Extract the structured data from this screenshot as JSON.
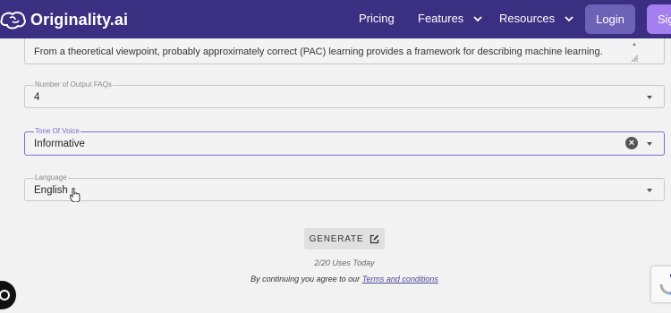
{
  "header": {
    "logo_text": "Originality.ai",
    "nav": [
      {
        "label": "Pricing"
      },
      {
        "label": "Features"
      },
      {
        "label": "Resources"
      }
    ],
    "login_label": "Login",
    "signup_label": "Sig"
  },
  "form": {
    "text_value": "From a theoretical viewpoint, probably approximately correct (PAC) learning provides a framework for describing machine learning.",
    "faqs": {
      "label": "Number of Output FAQs",
      "value": "4"
    },
    "tone": {
      "label": "Tone Of Voice",
      "value": "Informative"
    },
    "language": {
      "label": "Language",
      "value": "English"
    }
  },
  "actions": {
    "generate_label": "GENERATE",
    "uses_text": "2/20 Uses Today",
    "terms_prefix": "By continuing you agree to our ",
    "terms_link": "Terms and conditions"
  },
  "colors": {
    "nav_background": "#3b2f82",
    "focus_border": "#7a6fd1",
    "login_button": "#6d62b8",
    "signup_button": "#a47ff0"
  },
  "icons": [
    "brain-logo-icon",
    "chevron-down-icon",
    "clear-icon",
    "caret-down-icon",
    "edit-icon",
    "chat-icon",
    "recaptcha-icon",
    "hand-cursor-icon",
    "resize-grip-icon"
  ]
}
